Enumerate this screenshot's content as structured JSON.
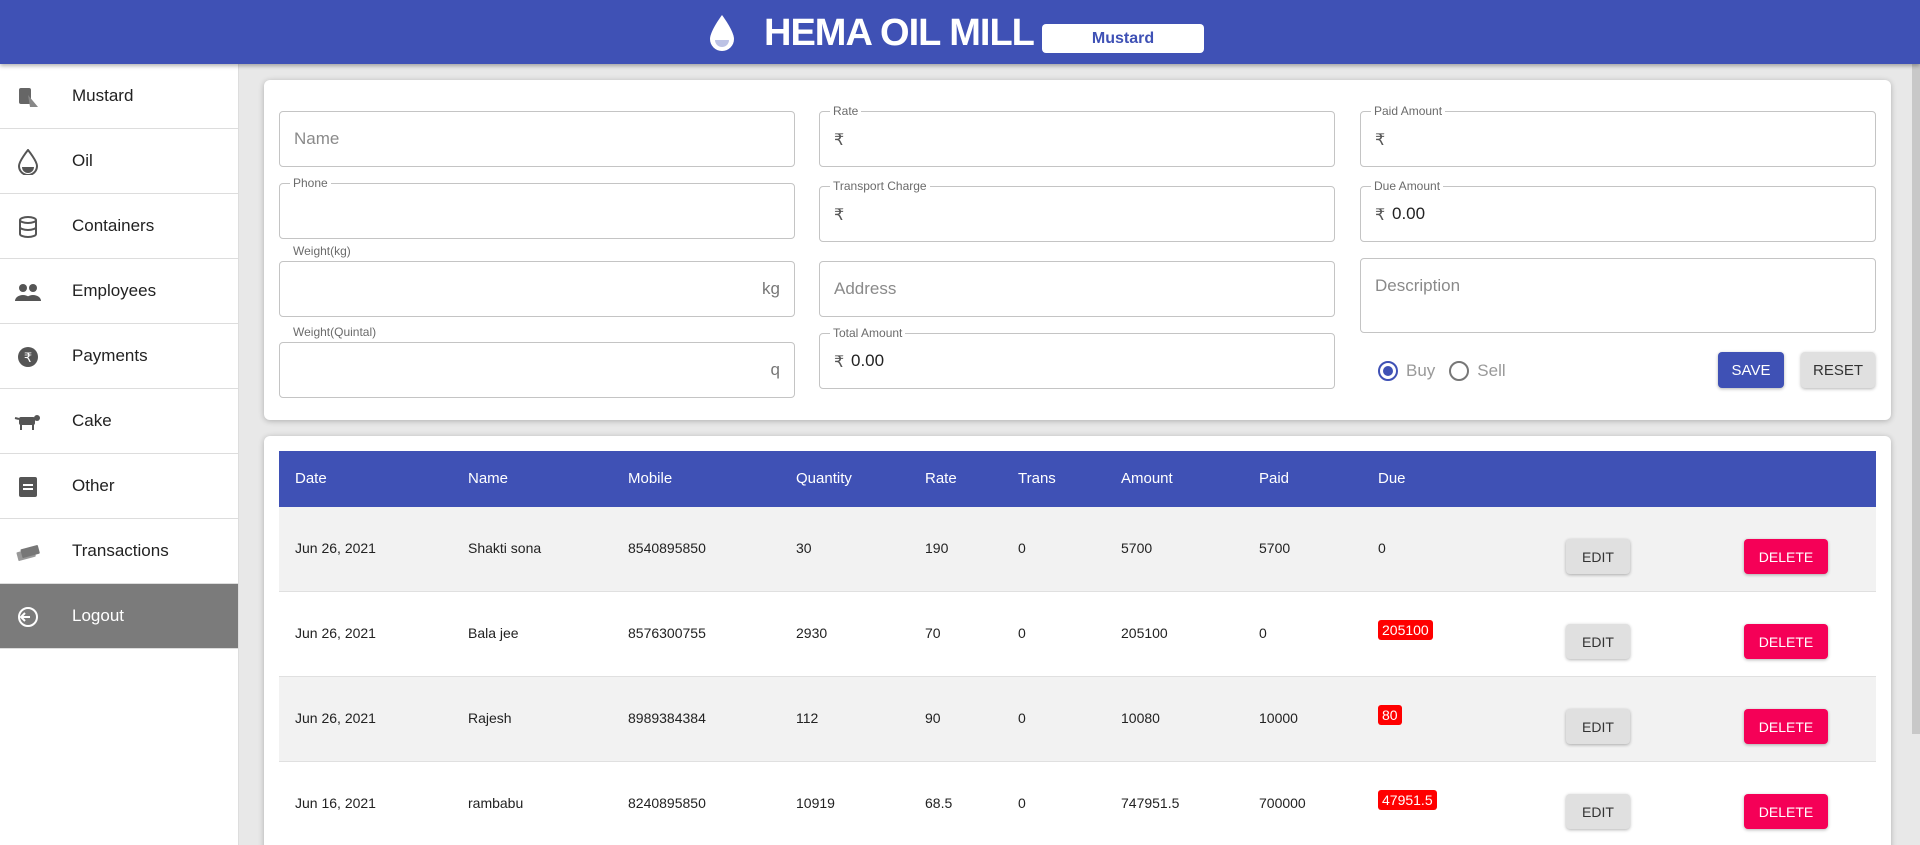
{
  "header": {
    "title": "HEMA OIL MILL",
    "product": "Mustard"
  },
  "sidebar": {
    "items": [
      {
        "label": "Mustard",
        "icon": "mustard-icon"
      },
      {
        "label": "Oil",
        "icon": "oil-drop-icon"
      },
      {
        "label": "Containers",
        "icon": "container-icon"
      },
      {
        "label": "Employees",
        "icon": "employees-icon"
      },
      {
        "label": "Payments",
        "icon": "rupee-icon"
      },
      {
        "label": "Cake",
        "icon": "cow-icon"
      },
      {
        "label": "Other",
        "icon": "document-icon"
      },
      {
        "label": "Transactions",
        "icon": "money-icon"
      },
      {
        "label": "Logout",
        "icon": "logout-icon"
      }
    ]
  },
  "form": {
    "name": {
      "placeholder": "Name"
    },
    "phone": {
      "label": "Phone"
    },
    "weight_kg": {
      "label": "Weight(kg)",
      "suffix": "kg"
    },
    "weight_quintal": {
      "label": "Weight(Quintal)",
      "suffix": "q"
    },
    "rate": {
      "label": "Rate",
      "prefix": "₹"
    },
    "transport": {
      "label": "Transport Charge",
      "prefix": "₹"
    },
    "address": {
      "placeholder": "Address"
    },
    "total": {
      "label": "Total Amount",
      "prefix": "₹",
      "value": "0.00"
    },
    "paid": {
      "label": "Paid Amount",
      "prefix": "₹"
    },
    "due": {
      "label": "Due Amount",
      "prefix": "₹",
      "value": "0.00"
    },
    "description": {
      "placeholder": "Description"
    },
    "radio": {
      "buy": "Buy",
      "sell": "Sell",
      "selected": "Buy"
    },
    "save_label": "SAVE",
    "reset_label": "RESET"
  },
  "table": {
    "headers": [
      "Date",
      "Name",
      "Mobile",
      "Quantity",
      "Rate",
      "Trans",
      "Amount",
      "Paid",
      "Due"
    ],
    "rows": [
      {
        "date": "Jun 26, 2021",
        "name": "Shakti sona",
        "mobile": "8540895850",
        "quantity": "30",
        "rate": "190",
        "trans": "0",
        "amount": "5700",
        "paid": "5700",
        "due": "0",
        "due_highlight": false
      },
      {
        "date": "Jun 26, 2021",
        "name": "Bala jee",
        "mobile": "8576300755",
        "quantity": "2930",
        "rate": "70",
        "trans": "0",
        "amount": "205100",
        "paid": "0",
        "due": "205100",
        "due_highlight": true
      },
      {
        "date": "Jun 26, 2021",
        "name": "Rajesh",
        "mobile": "8989384384",
        "quantity": "112",
        "rate": "90",
        "trans": "0",
        "amount": "10080",
        "paid": "10000",
        "due": "80",
        "due_highlight": true
      },
      {
        "date": "Jun 16, 2021",
        "name": "rambabu",
        "mobile": "8240895850",
        "quantity": "10919",
        "rate": "68.5",
        "trans": "0",
        "amount": "747951.5",
        "paid": "700000",
        "due": "47951.5",
        "due_highlight": true
      }
    ],
    "edit_label": "EDIT",
    "delete_label": "DELETE"
  },
  "colors": {
    "primary": "#3f51b5",
    "accent": "#f50057",
    "due_badge": "#ff0000",
    "active_nav": "#7b7b7b"
  }
}
